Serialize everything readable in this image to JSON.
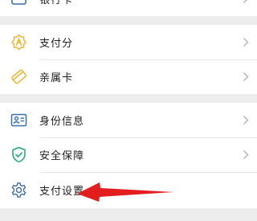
{
  "groups": [
    {
      "items": [
        {
          "key": "bank-card",
          "label": "银行卡",
          "icon": "bank-card-icon"
        }
      ]
    },
    {
      "items": [
        {
          "key": "payment-score",
          "label": "支付分",
          "icon": "score-badge-icon"
        },
        {
          "key": "family-card",
          "label": "亲属卡",
          "icon": "family-card-icon"
        }
      ]
    },
    {
      "items": [
        {
          "key": "identity-info",
          "label": "身份信息",
          "icon": "id-card-icon"
        },
        {
          "key": "security",
          "label": "安全保障",
          "icon": "shield-check-icon"
        },
        {
          "key": "payment-settings",
          "label": "支付设置",
          "icon": "gear-icon"
        }
      ]
    }
  ],
  "colors": {
    "background": "#ededed",
    "icon_yellow": "#f0b429",
    "icon_blue": "#3d6fa8",
    "icon_green": "#1aad73",
    "annotation_red": "#e31e1e"
  }
}
